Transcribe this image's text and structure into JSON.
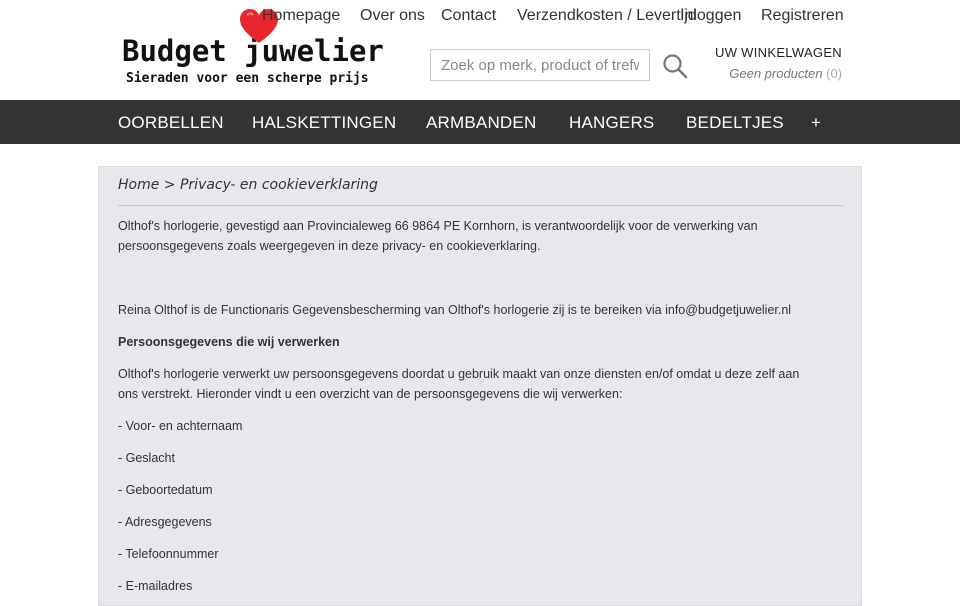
{
  "logo": {
    "title": "Budget juwelier",
    "tagline": "Sieraden voor een scherpe prijs",
    "heart_color": "#e8262e"
  },
  "topnav": {
    "items": [
      "Homepage",
      "Over ons",
      "Contact",
      "Verzendkosten / Levertijd",
      "Inloggen",
      "Registreren"
    ]
  },
  "search": {
    "placeholder": "Zoek op merk, product of trefwoord"
  },
  "cart": {
    "title": "UW WINKELWAGEN",
    "status": "Geen producten",
    "count": "(0)"
  },
  "mainnav": {
    "items": [
      "OORBELLEN",
      "HALSKETTINGEN",
      "ARMBANDEN",
      "HANGERS",
      "BEDELTJES",
      "+"
    ]
  },
  "breadcrumb": {
    "home": "Home",
    "separator": ">",
    "current": "Privacy- en cookieverklaring"
  },
  "content": {
    "p1_line1": "Olthof's horlogerie, gevestigd aan Provincialeweg 66 9864 PE Kornhorn, is verantwoordelijk voor de verwerking van",
    "p1_line2": "persoonsgegevens zoals weergegeven in deze privacy- en cookieverklaring.",
    "p2": "Reina Olthof is de Functionaris Gegevensbescherming van Olthof's horlogerie zij is te bereiken via info@budgetjuwelier.nl",
    "heading": "Persoonsgegevens die wij verwerken",
    "p3_line1": "Olthof's horlogerie verwerkt uw persoonsgegevens doordat u gebruik maakt van onze diensten en/of omdat u deze zelf aan",
    "p3_line2": "ons verstrekt. Hieronder vindt u een overzicht van de persoonsgegevens die wij verwerken:",
    "list": [
      "- Voor- en achternaam",
      "- Geslacht",
      "- Geboortedatum",
      "- Adresgegevens",
      "- Telefoonnummer",
      "- E-mailadres"
    ]
  },
  "colors": {
    "nav_bg": "#333333",
    "content_bg": "#e8e8ec"
  }
}
